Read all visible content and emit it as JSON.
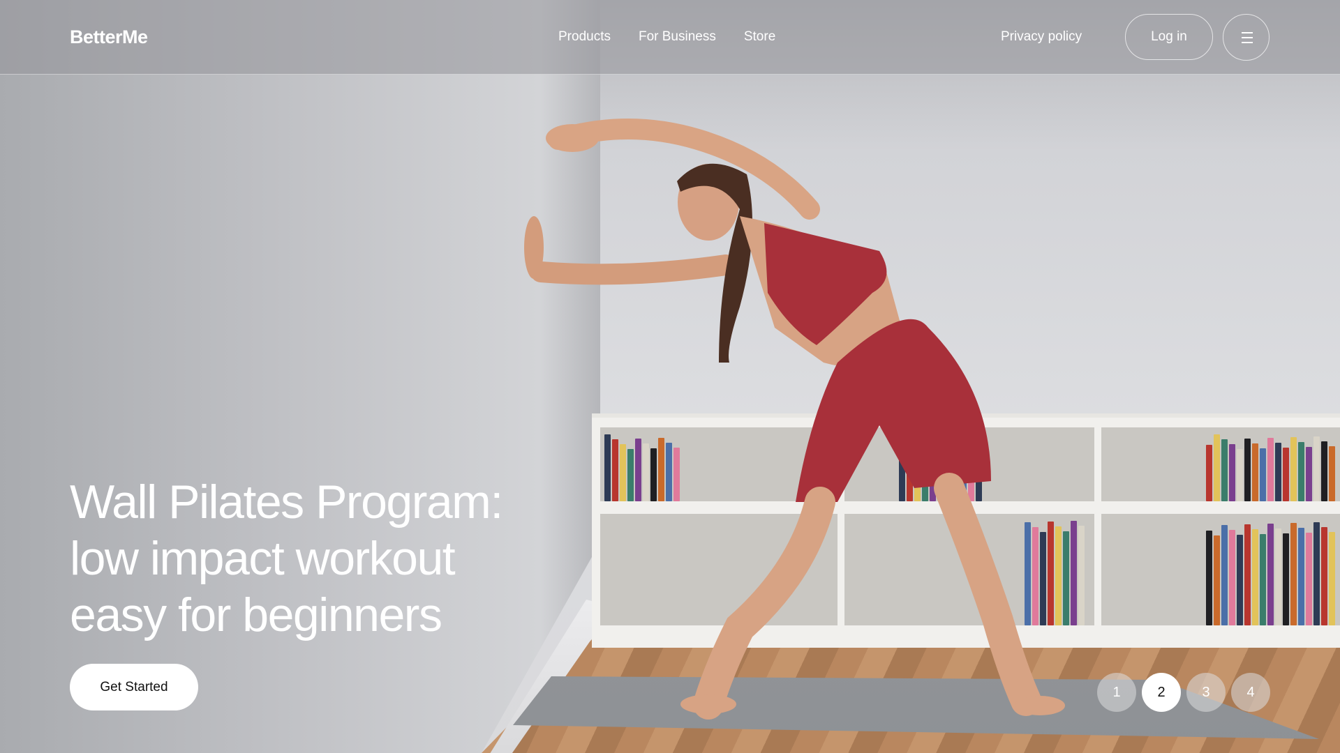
{
  "header": {
    "logo": "BetterMe",
    "nav": [
      {
        "label": "Products"
      },
      {
        "label": "For Business"
      },
      {
        "label": "Store"
      }
    ],
    "privacy": "Privacy policy",
    "login": "Log in",
    "menu_icon": "hamburger-menu-icon"
  },
  "hero": {
    "headline_lines": [
      "Wall Pilates Program:",
      "low impact workout",
      "easy for beginners"
    ],
    "cta": "Get Started",
    "slides": [
      "1",
      "2",
      "3",
      "4"
    ],
    "active_slide": "2"
  },
  "colors": {
    "outfit": "#a8303a",
    "cta_bg": "#ffffff",
    "header_tint": "#96969b"
  }
}
